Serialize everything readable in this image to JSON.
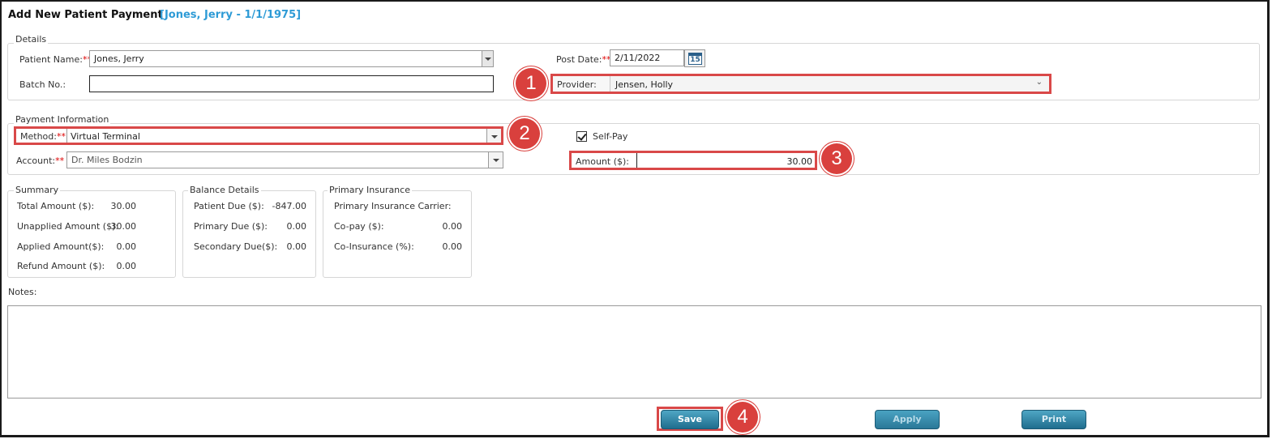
{
  "header": {
    "title": "Add New Patient Payment",
    "patient_tag": "[Jones, Jerry  - 1/1/1975]"
  },
  "details": {
    "legend": "Details",
    "patient_name_label": "Patient Name:",
    "patient_name_value": "Jones, Jerry",
    "batch_label": "Batch No.:",
    "batch_value": "",
    "post_date_label": "Post Date:",
    "post_date_value": "2/11/2022",
    "calendar_day": "15",
    "provider_label": "Provider:",
    "provider_value": "Jensen, Holly",
    "required_mark": "**"
  },
  "payment": {
    "legend": "Payment Information",
    "method_label": "Method:",
    "method_value": "Virtual Terminal",
    "account_label": "Account:",
    "account_value": "Dr. Miles Bodzin",
    "self_pay_label": "Self-Pay",
    "self_pay_checked": true,
    "amount_label": "Amount ($):",
    "amount_value": "30.00"
  },
  "summary": {
    "legend": "Summary",
    "rows": [
      {
        "label": "Total Amount ($):",
        "value": "30.00"
      },
      {
        "label": "Unapplied Amount ($):",
        "value": "30.00"
      },
      {
        "label": "Applied Amount($):",
        "value": "0.00"
      },
      {
        "label": "Refund Amount ($):",
        "value": "0.00"
      }
    ]
  },
  "balance": {
    "legend": "Balance Details",
    "rows": [
      {
        "label": "Patient Due ($):",
        "value": "-847.00"
      },
      {
        "label": "Primary Due ($):",
        "value": "0.00"
      },
      {
        "label": "Secondary Due($):",
        "value": "0.00"
      }
    ]
  },
  "insurance": {
    "legend": "Primary Insurance",
    "rows": [
      {
        "label": "Primary Insurance Carrier:",
        "value": ""
      },
      {
        "label": "Co-pay ($):",
        "value": "0.00"
      },
      {
        "label": "Co-Insurance (%):",
        "value": "0.00"
      }
    ]
  },
  "notes": {
    "label": "Notes:",
    "value": ""
  },
  "buttons": {
    "save": "Save",
    "apply": "Apply",
    "print": "Print"
  },
  "callouts": [
    "1",
    "2",
    "3",
    "4"
  ],
  "colors": {
    "accent": "#2e9bd6",
    "highlight": "#d94848",
    "badge": "#d9403d",
    "button": "#1f6d8e"
  }
}
